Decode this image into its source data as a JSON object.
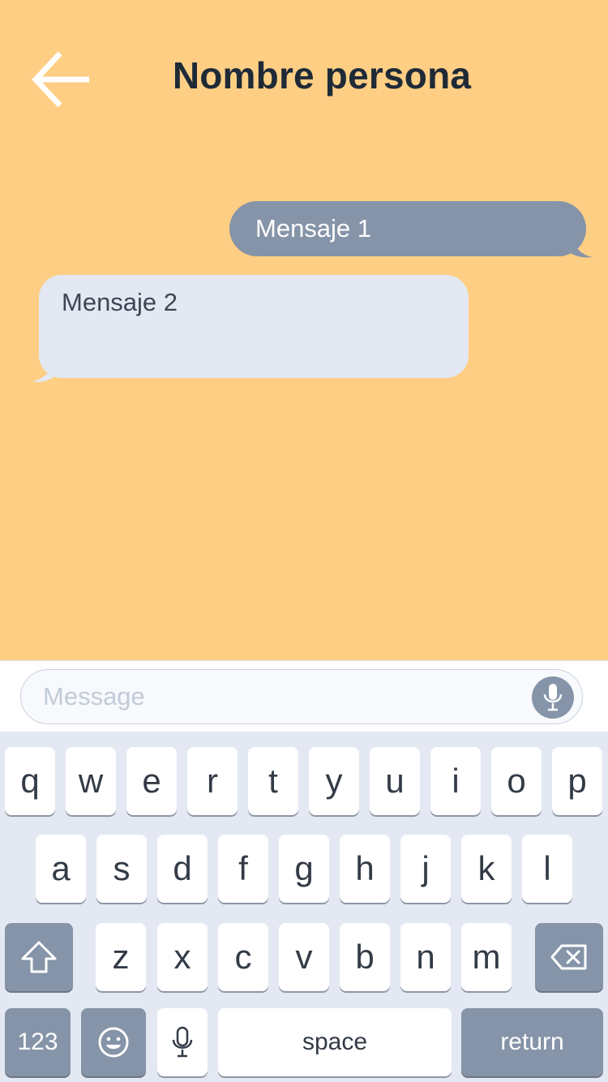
{
  "header": {
    "title": "Nombre persona",
    "back_icon": "arrow-left-icon"
  },
  "messages": [
    {
      "direction": "outgoing",
      "text": "Mensaje 1"
    },
    {
      "direction": "incoming",
      "text": "Mensaje 2"
    }
  ],
  "composer": {
    "placeholder": "Message",
    "value": "",
    "mic_icon": "microphone-icon"
  },
  "keyboard": {
    "row1": [
      "q",
      "w",
      "e",
      "r",
      "t",
      "y",
      "u",
      "i",
      "o",
      "p"
    ],
    "row2": [
      "a",
      "s",
      "d",
      "f",
      "g",
      "h",
      "j",
      "k",
      "l"
    ],
    "row3": [
      "z",
      "x",
      "c",
      "v",
      "b",
      "n",
      "m"
    ],
    "shift_icon": "shift-icon",
    "backspace_icon": "backspace-icon",
    "numbers_label": "123",
    "emoji_icon": "emoji-icon",
    "dictation_icon": "microphone-icon",
    "space_label": "space",
    "return_label": "return"
  },
  "colors": {
    "background": "#FECE84",
    "accent": "#8594A8",
    "incoming_bubble": "#E3E8F3",
    "title_text": "#1F2A37"
  }
}
